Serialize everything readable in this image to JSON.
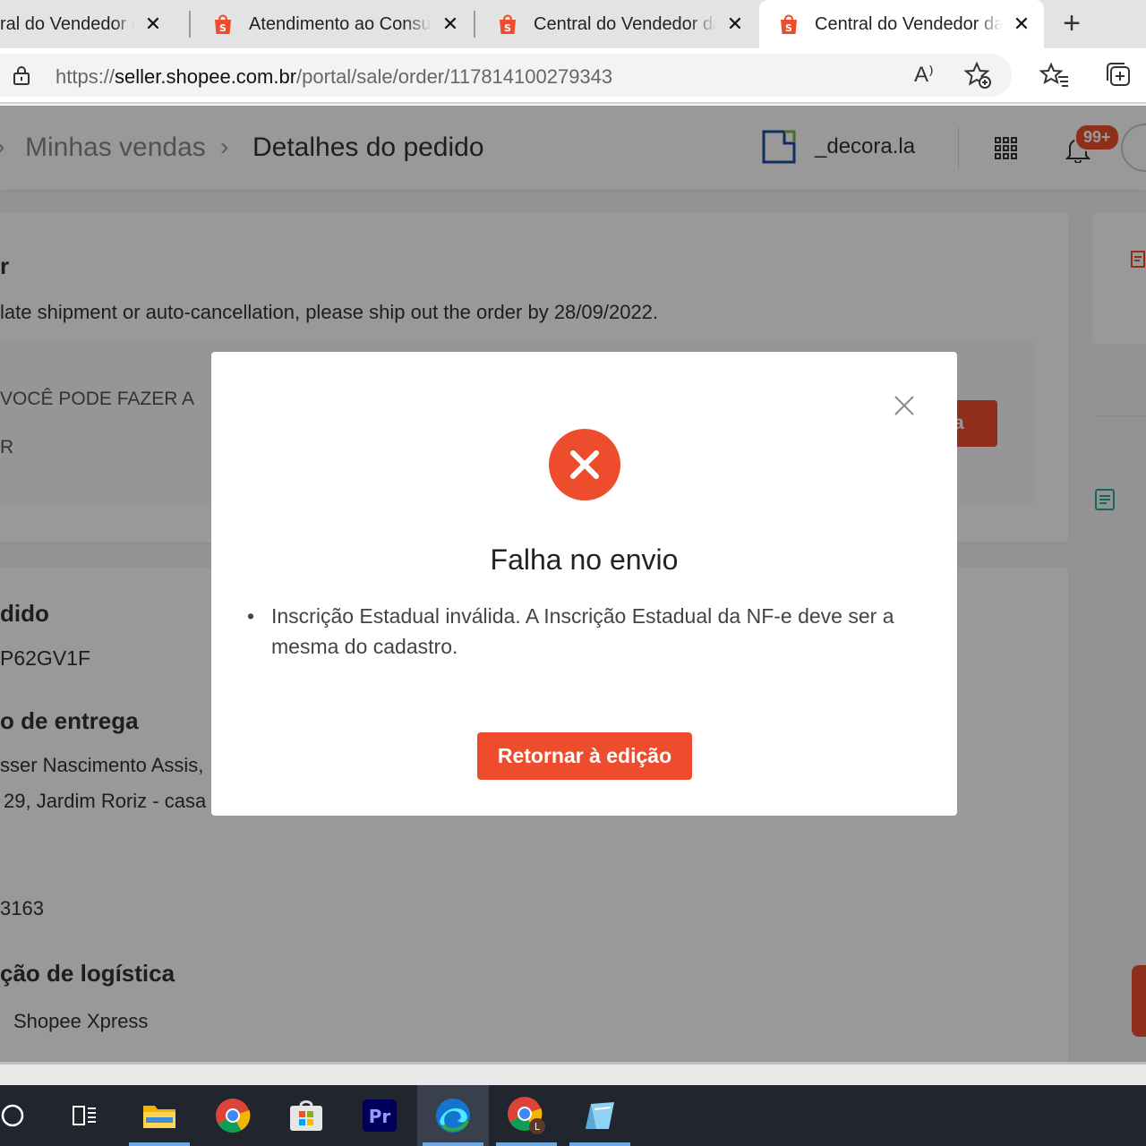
{
  "browser": {
    "tabs": [
      {
        "title": "ral do Vendedor da"
      },
      {
        "title": "Atendimento ao Consumidor"
      },
      {
        "title": "Central do Vendedor da"
      },
      {
        "title": "Central do Vendedor da"
      }
    ],
    "tab_close_glyph": "✕",
    "new_tab_glyph": "+",
    "url_prefix": "https://",
    "url_host": "seller.shopee.com.br",
    "url_path": "/portal/sale/order/117814100279343",
    "read_aloud_label": "A⁾"
  },
  "nav": {
    "breadcrumb": [
      "Minhas vendas",
      "Detalhes do pedido"
    ],
    "shop_name": "_decora.la",
    "notification_count": "99+"
  },
  "order": {
    "status_title": "r",
    "ship_notice": "late shipment or auto-cancellation, please ship out the order by 28/09/2022.",
    "hint_line1": "VOCÊ PODE FAZER A",
    "hint_line2": "R",
    "action_button_partial": "ta",
    "order_id_title": "dido",
    "order_id_value": "P62GV1F",
    "address_title": "o de entrega",
    "address_line1": "sser Nascimento Assis,",
    "address_line2": "29, Jardim Roriz - casa",
    "phone_partial": "3163",
    "logistics_title": "ção de logística",
    "logistics_value": "Shopee Xpress"
  },
  "modal": {
    "title": "Falha no envio",
    "messages": [
      "Inscrição Estadual inválida. A Inscrição Estadual da NF-e deve ser a mesma do cadastro."
    ],
    "button_label": "Retornar à edição"
  },
  "colors": {
    "shopee_orange": "#ee4d2d",
    "taskbar": "#20252e",
    "teal_icon": "#26aa99"
  },
  "taskbar_icons": [
    "search-icon",
    "task-view-icon",
    "file-explorer-icon",
    "chrome-icon",
    "microsoft-store-icon",
    "premiere-pro-icon",
    "edge-icon",
    "chrome-profile-icon",
    "notes-app-icon"
  ]
}
